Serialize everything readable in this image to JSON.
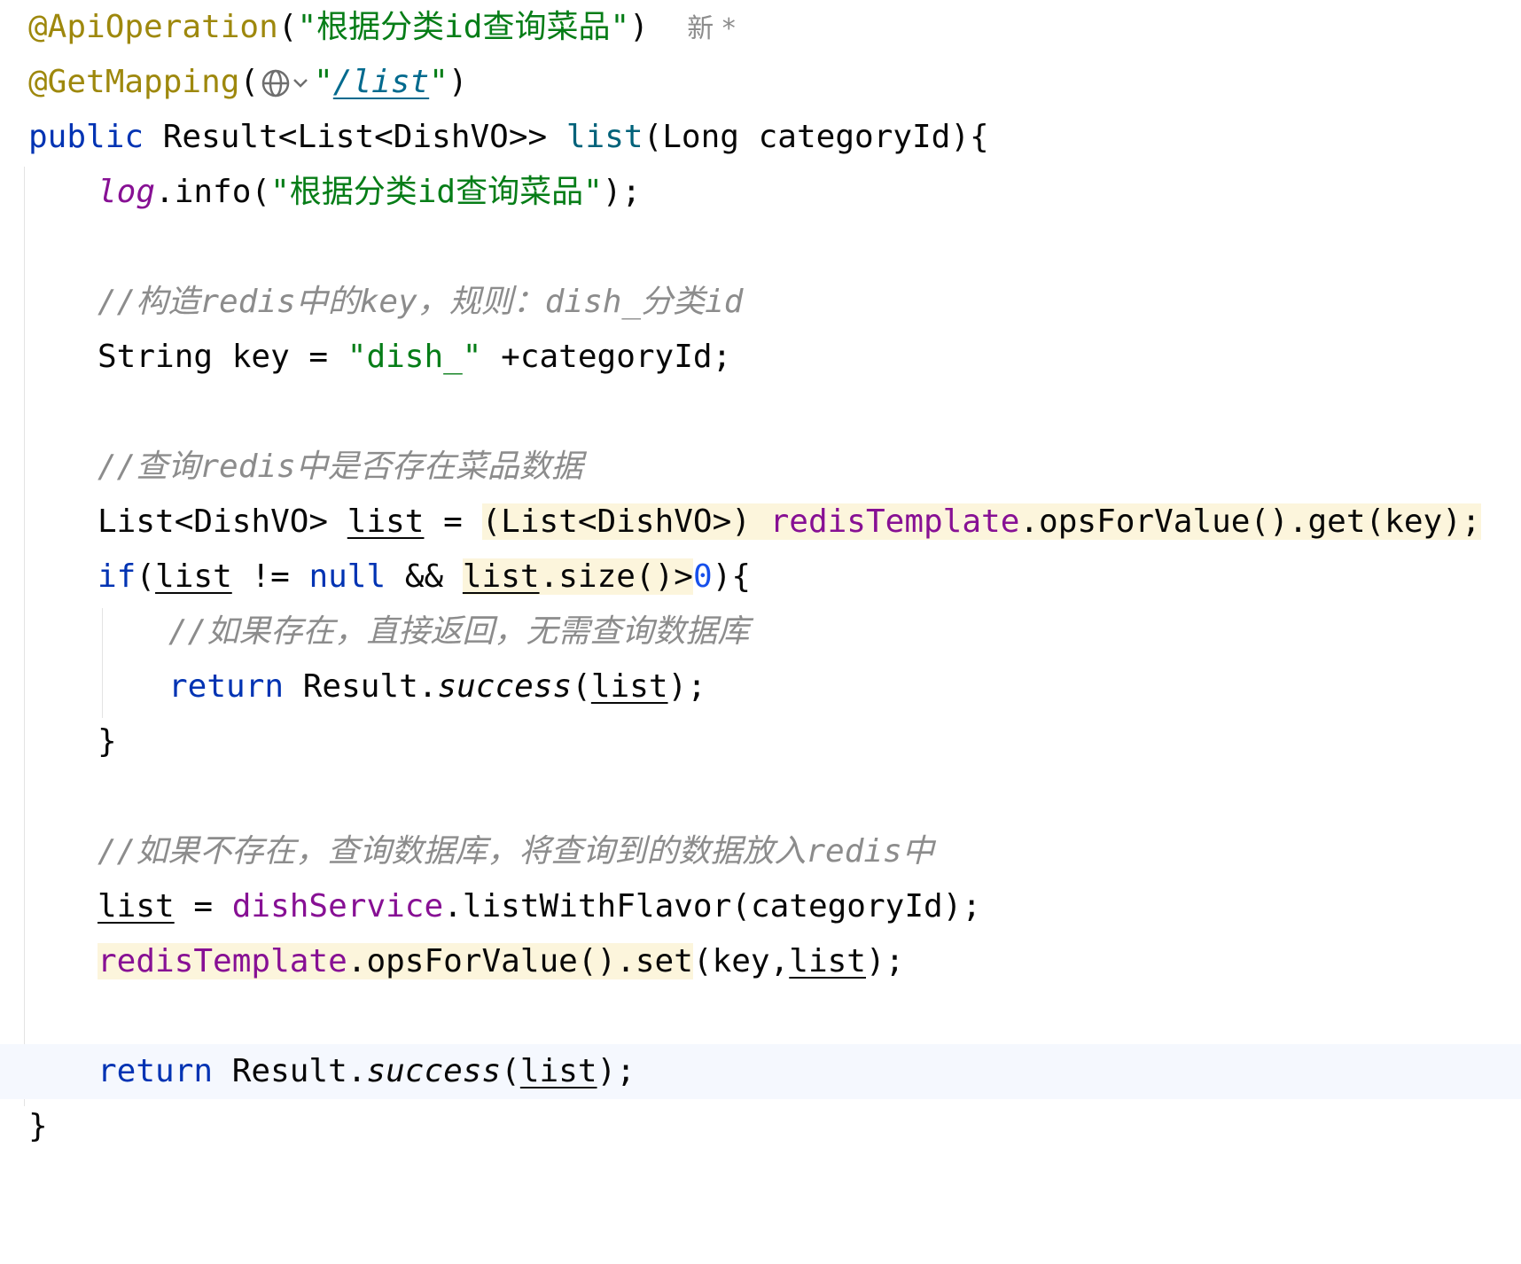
{
  "editor": {
    "lines": {
      "l1": {
        "annotation": "@ApiOperation",
        "open": "(",
        "string": "\"根据分类id查询菜品\"",
        "close": ")",
        "hint_text": "新",
        "hint_star": "*"
      },
      "l2": {
        "annotation": "@GetMapping",
        "open": "(",
        "quote_open": "\"",
        "path": "/list",
        "quote_close": "\"",
        "close": ")"
      },
      "l3": {
        "kw": "public",
        "type": " Result<List<DishVO>> ",
        "method": "list",
        "params": "(Long categoryId){"
      },
      "l4": {
        "field": "log",
        "call": ".info(",
        "string": "\"根据分类id查询菜品\"",
        "end": ");"
      },
      "l6": {
        "comment": "//构造redis中的key，规则：dish_分类id"
      },
      "l7": {
        "pre": "String key = ",
        "string": "\"dish_\"",
        "post": " +categoryId;"
      },
      "l9": {
        "comment": "//查询redis中是否存在菜品数据"
      },
      "l10": {
        "pre": "List<DishVO> ",
        "var": "list",
        "eq": " = ",
        "cast": "(List<DishVO>) ",
        "field": "redisTemplate",
        "call": ".opsForValue().get(key);"
      },
      "l11": {
        "kw": "if",
        "open": "(",
        "var1": "list",
        "ne": " != ",
        "null": "null",
        "and": " && ",
        "var2": "list",
        "size": ".size()>",
        "num": "0",
        "close": "){"
      },
      "l12": {
        "comment": "//如果存在，直接返回，无需查询数据库"
      },
      "l13": {
        "kw": "return",
        "cls": " Result.",
        "method": "success",
        "open": "(",
        "var": "list",
        "end": ");"
      },
      "l14": {
        "brace": "}"
      },
      "l16": {
        "comment": "//如果不存在，查询数据库，将查询到的数据放入redis中"
      },
      "l17": {
        "var": "list",
        "eq": " = ",
        "field": "dishService",
        "call": ".listWithFlavor(categoryId);"
      },
      "l18": {
        "field": "redisTemplate",
        "call": ".opsForValue().set",
        "args_open": "(key,",
        "var": "list",
        "end": ");"
      },
      "l20": {
        "kw": "return",
        "cls": " Result.",
        "method": "success",
        "open": "(",
        "var": "list",
        "end": ");"
      },
      "l21": {
        "brace": "}"
      }
    }
  }
}
